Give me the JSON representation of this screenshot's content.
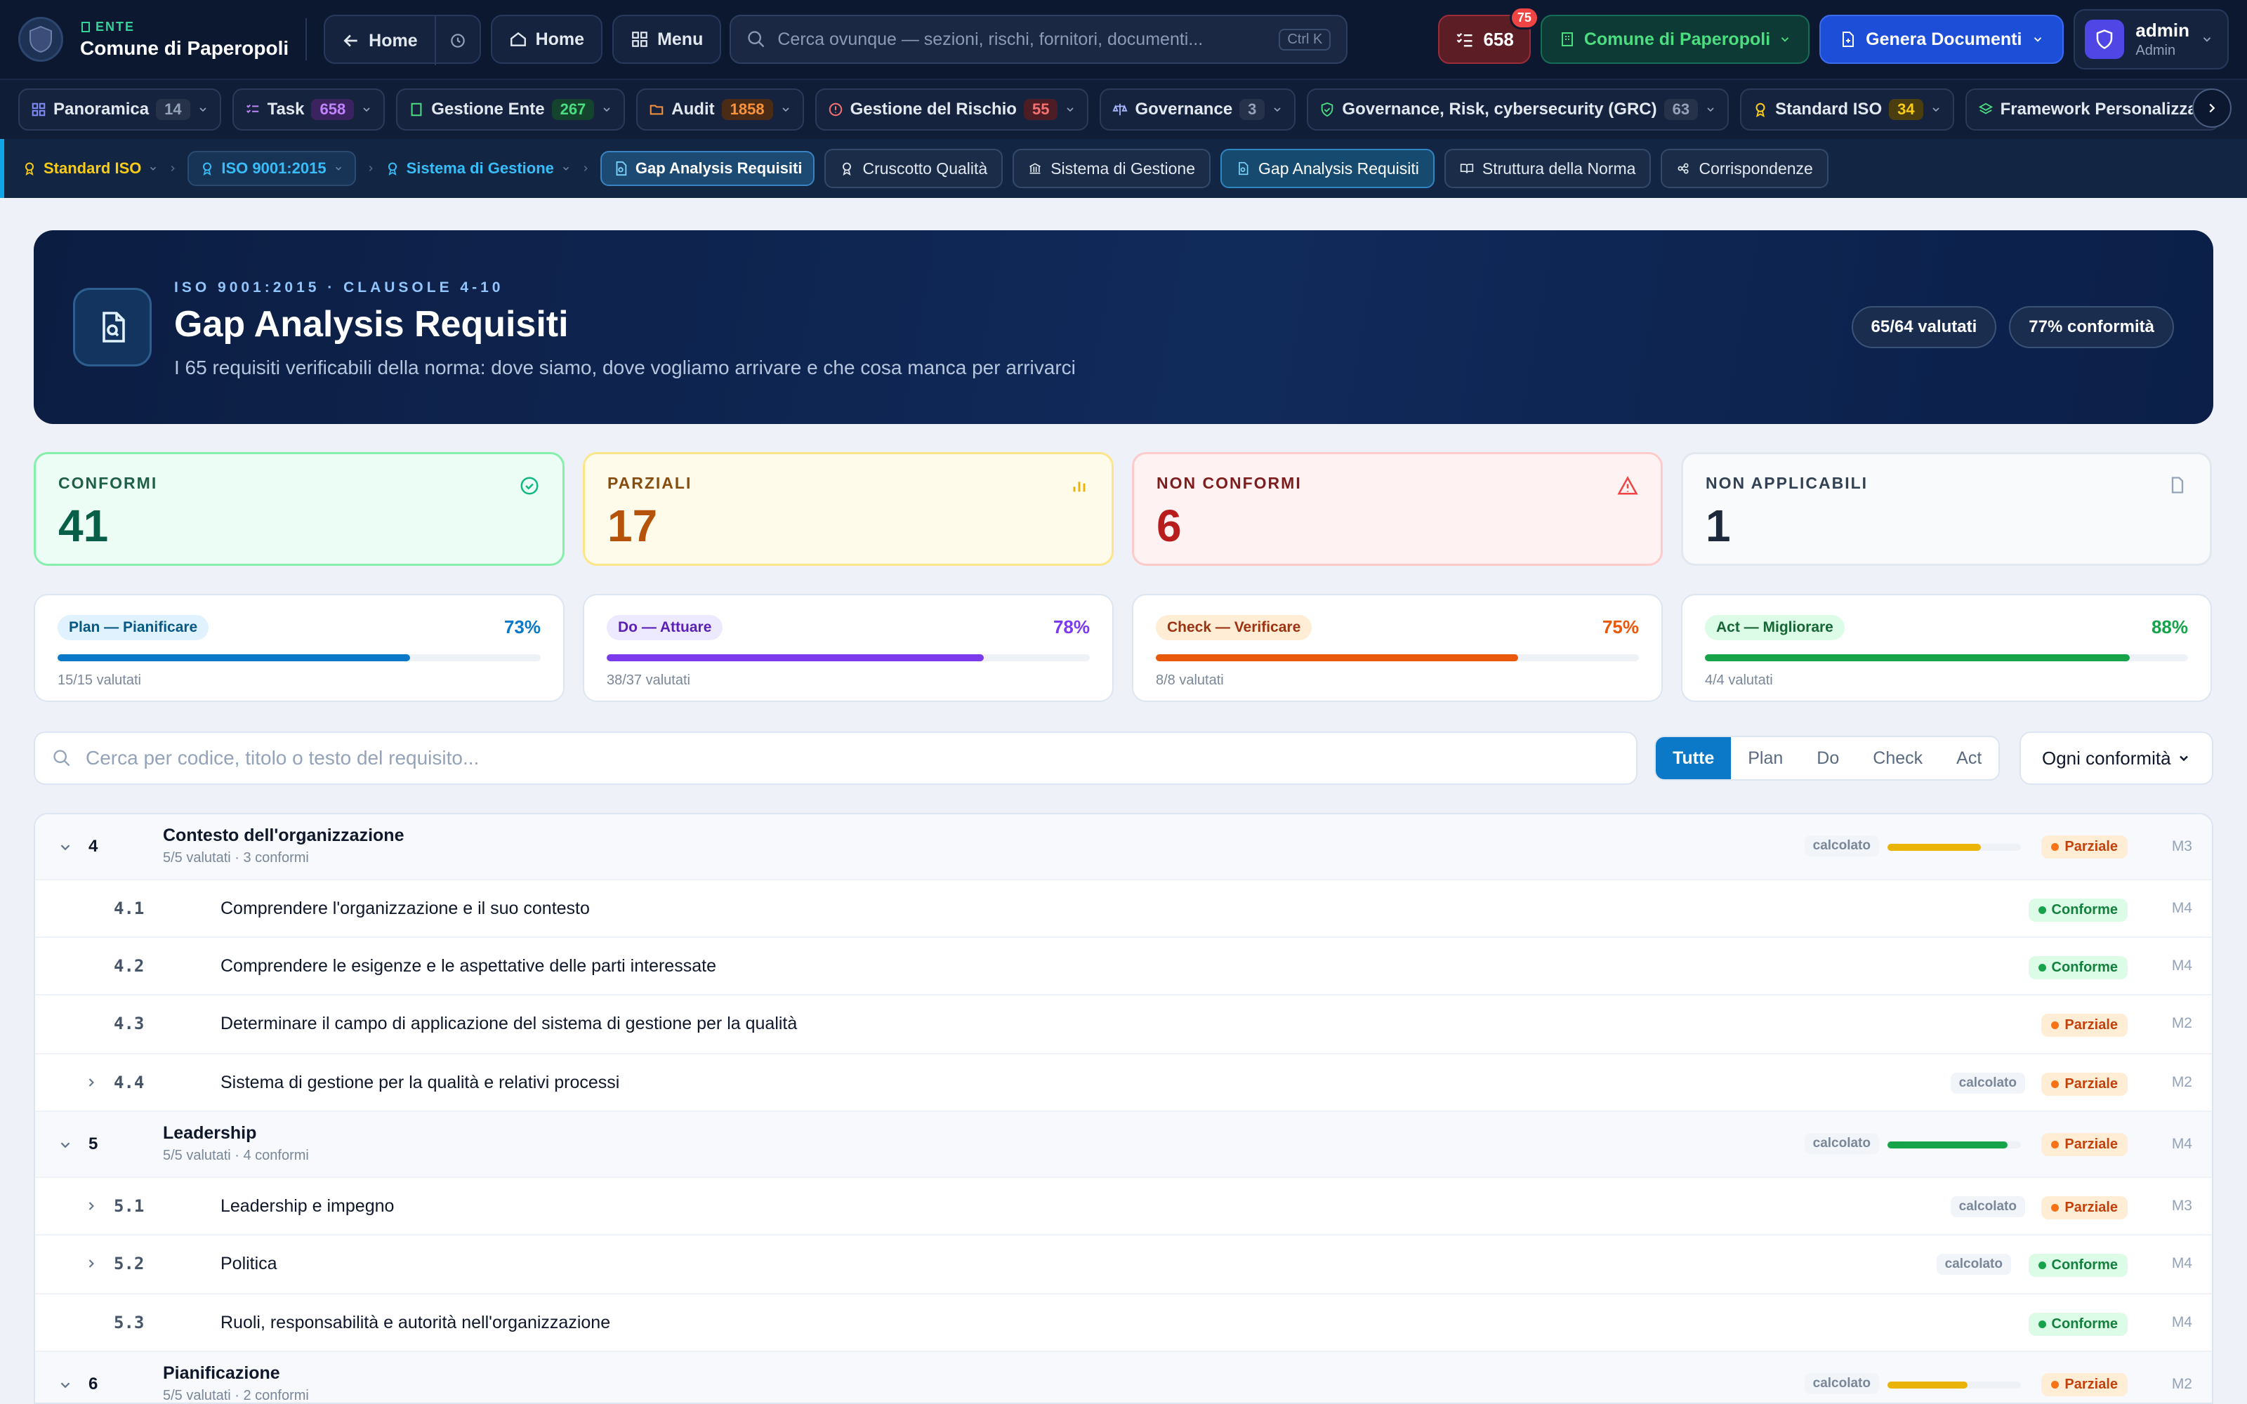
{
  "app": {
    "ente_label": "ENTE",
    "ente_name": "Comune di Paperopoli"
  },
  "toolbar": {
    "back_home": "Home",
    "home": "Home",
    "menu": "Menu",
    "search_placeholder": "Cerca ovunque — sezioni, rischi, fornitori, documenti...",
    "search_shortcut": "Ctrl K",
    "tasks_count": "658",
    "tasks_badge": "75",
    "ente_select": "Comune di Paperopoli",
    "generate": "Genera Documenti",
    "user_name": "admin",
    "user_role": "Admin"
  },
  "modules": [
    {
      "label": "Panoramica",
      "count": "14"
    },
    {
      "label": "Task",
      "count": "658"
    },
    {
      "label": "Gestione Ente",
      "count": "267"
    },
    {
      "label": "Audit",
      "count": "1858"
    },
    {
      "label": "Gestione del Rischio",
      "count": "55"
    },
    {
      "label": "Governance",
      "count": "3"
    },
    {
      "label": "Governance, Risk, cybersecurity (GRC)",
      "count": "63"
    },
    {
      "label": "Standard ISO",
      "count": "34"
    },
    {
      "label": "Framework Personalizzati",
      "count": ""
    }
  ],
  "breadcrumb": {
    "standard": "Standard ISO",
    "norm": "ISO 9001:2015",
    "system": "Sistema di Gestione",
    "current": "Gap Analysis Requisiti"
  },
  "subtabs": [
    "Cruscotto Qualità",
    "Sistema di Gestione",
    "Gap Analysis Requisiti",
    "Struttura della Norma",
    "Corrispondenze"
  ],
  "hero": {
    "tag": "ISO 9001:2015 · CLAUSOLE 4-10",
    "title": "Gap Analysis Requisiti",
    "subtitle": "I 65 requisiti verificabili della norma: dove siamo, dove vogliamo arrivare e che cosa manca per arrivarci",
    "evaluated": "65/64 valutati",
    "compliance": "77% conformità"
  },
  "kpis": [
    {
      "label": "CONFORMI",
      "value": "41"
    },
    {
      "label": "PARZIALI",
      "value": "17"
    },
    {
      "label": "NON CONFORMI",
      "value": "6"
    },
    {
      "label": "NON APPLICABILI",
      "value": "1"
    }
  ],
  "phases": [
    {
      "label": "Plan — Pianificare",
      "pct": "73%",
      "progress": 0.73,
      "sub": "15/15 valutati"
    },
    {
      "label": "Do — Attuare",
      "pct": "78%",
      "progress": 0.78,
      "sub": "38/37 valutati"
    },
    {
      "label": "Check — Verificare",
      "pct": "75%",
      "progress": 0.75,
      "sub": "8/8 valutati"
    },
    {
      "label": "Act — Migliorare",
      "pct": "88%",
      "progress": 0.88,
      "sub": "4/4 valutati"
    }
  ],
  "filters": {
    "search_placeholder": "Cerca per codice, titolo o testo del requisito...",
    "segments": [
      "Tutte",
      "Plan",
      "Do",
      "Check",
      "Act"
    ],
    "conformity": "Ogni conformità"
  },
  "computed_label": "calcolato",
  "status_labels": {
    "conforme": "Conforme",
    "parziale": "Parziale"
  },
  "rows": [
    {
      "code": "4",
      "title": "Contesto dell'organizzazione",
      "sub": "5/5 valutati · 3 conformi",
      "status": "Parziale",
      "maturity": "M3",
      "progress": 0.7
    },
    {
      "code": "4.1",
      "title": "Comprendere l'organizzazione e il suo contesto",
      "status": "Conforme",
      "maturity": "M4"
    },
    {
      "code": "4.2",
      "title": "Comprendere le esigenze e le aspettative delle parti interessate",
      "status": "Conforme",
      "maturity": "M4"
    },
    {
      "code": "4.3",
      "title": "Determinare il campo di applicazione del sistema di gestione per la qualità",
      "status": "Parziale",
      "maturity": "M2"
    },
    {
      "code": "4.4",
      "title": "Sistema di gestione per la qualità e relativi processi",
      "status": "Parziale",
      "maturity": "M2"
    },
    {
      "code": "5",
      "title": "Leadership",
      "sub": "5/5 valutati · 4 conformi",
      "status": "Parziale",
      "maturity": "M4",
      "progress": 0.9
    },
    {
      "code": "5.1",
      "title": "Leadership e impegno",
      "status": "Parziale",
      "maturity": "M3"
    },
    {
      "code": "5.2",
      "title": "Politica",
      "status": "Conforme",
      "maturity": "M4"
    },
    {
      "code": "5.3",
      "title": "Ruoli, responsabilità e autorità nell'organizzazione",
      "status": "Conforme",
      "maturity": "M4"
    },
    {
      "code": "6",
      "title": "Pianificazione",
      "sub": "5/5 valutati · 2 conformi",
      "status": "Parziale",
      "maturity": "M2",
      "progress": 0.6
    }
  ],
  "colors": {
    "plan": "#0b79c8",
    "do": "#7c3aed",
    "check": "#ea580c",
    "act": "#16a34a",
    "accent": "#0ea5e9"
  }
}
